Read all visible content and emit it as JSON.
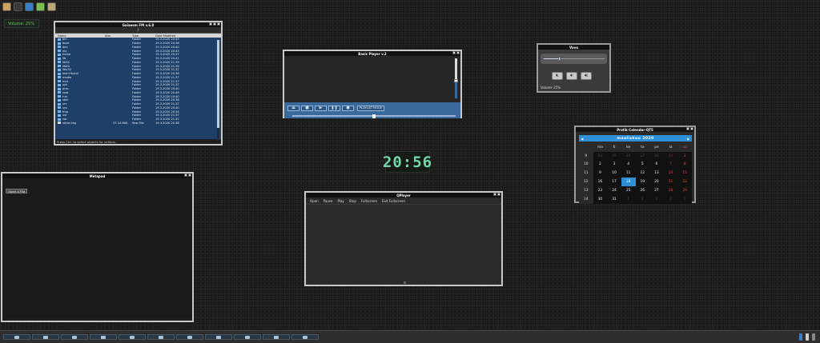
{
  "launcher": {
    "icons": [
      {
        "name": "file-manager-launcher-icon",
        "color": "#c8a060"
      },
      {
        "name": "terminal-launcher-icon",
        "color": "#3a3a3a"
      },
      {
        "name": "browser-launcher-icon",
        "color": "#3a7ec8"
      },
      {
        "name": "editor-launcher-icon",
        "color": "#7ac050"
      },
      {
        "name": "settings-launcher-icon",
        "color": "#b8a878"
      }
    ]
  },
  "volume_indicator": {
    "text": "Volume: 25%"
  },
  "file_manager": {
    "title": "Gaiaesm FM v.6.0",
    "path": "/",
    "columns": {
      "name": "Name",
      "size": "Size",
      "type": "Type",
      "date": "Date Modified"
    },
    "rows": [
      {
        "name": "bin",
        "size": "",
        "type": "Folder",
        "date": "19.3.2020 20.45"
      },
      {
        "name": "boot",
        "size": "",
        "type": "Folder",
        "date": "19.3.2020 20.38"
      },
      {
        "name": "dev",
        "size": "",
        "type": "Folder",
        "date": "19.3.2020 20.40"
      },
      {
        "name": "etc",
        "size": "",
        "type": "Folder",
        "date": "19.3.2020 20.45"
      },
      {
        "name": "home",
        "size": "",
        "type": "Folder",
        "date": "15.3.2020 20.37"
      },
      {
        "name": "lib",
        "size": "",
        "type": "Folder",
        "date": "19.3.2020 20.41"
      },
      {
        "name": "lib32",
        "size": "",
        "type": "Folder",
        "date": "15.3.2020 21.39"
      },
      {
        "name": "lib64",
        "size": "",
        "type": "Folder",
        "date": "15.3.2020 21.39"
      },
      {
        "name": "libx32",
        "size": "",
        "type": "Folder",
        "date": "15.3.2020 21.37"
      },
      {
        "name": "lost+found",
        "size": "",
        "type": "Folder",
        "date": "15.3.2020 20.38"
      },
      {
        "name": "media",
        "size": "",
        "type": "Folder",
        "date": "15.3.2020 21.37"
      },
      {
        "name": "mnt",
        "size": "",
        "type": "Folder",
        "date": "15.3.2020 21.37"
      },
      {
        "name": "opt",
        "size": "",
        "type": "Folder",
        "date": "15.3.2020 21.37"
      },
      {
        "name": "proc",
        "size": "",
        "type": "Folder",
        "date": "19.3.2020 20.40"
      },
      {
        "name": "root",
        "size": "",
        "type": "Folder",
        "date": "19.3.2020 20.49"
      },
      {
        "name": "run",
        "size": "",
        "type": "Folder",
        "date": "19.3.2020 20.40"
      },
      {
        "name": "sbin",
        "size": "",
        "type": "Folder",
        "date": "19.3.2020 20.38"
      },
      {
        "name": "srv",
        "size": "",
        "type": "Folder",
        "date": "15.3.2020 21.37"
      },
      {
        "name": "sys",
        "size": "",
        "type": "Folder",
        "date": "19.3.2020 20.40"
      },
      {
        "name": "tmp",
        "size": "",
        "type": "Folder",
        "date": "19.3.2020 20.54"
      },
      {
        "name": "usr",
        "size": "",
        "type": "Folder",
        "date": "15.3.2020 21.37"
      },
      {
        "name": "var",
        "size": "",
        "type": "Folder",
        "date": "15.3.2020 21.37"
      },
      {
        "name": "initrd.img",
        "size": "57.14 MiB",
        "type": "Raw File",
        "date": "19.3.2020 20.38"
      }
    ],
    "status": "Press Ctrl. to select objects for actions."
  },
  "basic_player": {
    "title": "Basic Player v.2",
    "buttons": [
      {
        "name": "eject-button",
        "glyph": "⏏"
      },
      {
        "name": "stop-button",
        "glyph": "■"
      },
      {
        "name": "play-button",
        "glyph": "▶"
      },
      {
        "name": "pause-button",
        "glyph": "❚❚"
      },
      {
        "name": "record-button",
        "glyph": "●"
      }
    ],
    "mode_label": "PLAYLIST MODE",
    "volume_level": 0.45,
    "position": 0.5
  },
  "volume_widget": {
    "title": "Vovo",
    "level": 0.25,
    "label": "Volume 25%"
  },
  "calendar": {
    "title": "Pratik Calendar-QT5",
    "month_label": "maaliskuu  2020",
    "weekdays": [
      "ma",
      "ti",
      "ke",
      "to",
      "pe",
      "la",
      "su"
    ],
    "weeks": [
      {
        "wk": "9",
        "days": [
          {
            "d": "24",
            "o": true
          },
          {
            "d": "25",
            "o": true
          },
          {
            "d": "26",
            "o": true
          },
          {
            "d": "27",
            "o": true
          },
          {
            "d": "28",
            "o": true
          },
          {
            "d": "29",
            "o": true
          },
          {
            "d": "1"
          }
        ]
      },
      {
        "wk": "10",
        "days": [
          {
            "d": "2"
          },
          {
            "d": "3"
          },
          {
            "d": "4"
          },
          {
            "d": "5"
          },
          {
            "d": "6"
          },
          {
            "d": "7"
          },
          {
            "d": "8"
          }
        ]
      },
      {
        "wk": "11",
        "days": [
          {
            "d": "9"
          },
          {
            "d": "10"
          },
          {
            "d": "11"
          },
          {
            "d": "12"
          },
          {
            "d": "13"
          },
          {
            "d": "14"
          },
          {
            "d": "15"
          }
        ]
      },
      {
        "wk": "12",
        "days": [
          {
            "d": "16"
          },
          {
            "d": "17"
          },
          {
            "d": "18",
            "t": true
          },
          {
            "d": "19"
          },
          {
            "d": "20"
          },
          {
            "d": "21"
          },
          {
            "d": "22"
          }
        ]
      },
      {
        "wk": "13",
        "days": [
          {
            "d": "23"
          },
          {
            "d": "24"
          },
          {
            "d": "25"
          },
          {
            "d": "26"
          },
          {
            "d": "27"
          },
          {
            "d": "28"
          },
          {
            "d": "29"
          }
        ]
      },
      {
        "wk": "14",
        "days": [
          {
            "d": "30"
          },
          {
            "d": "31"
          },
          {
            "d": "1",
            "o": true
          },
          {
            "d": "2",
            "o": true
          },
          {
            "d": "3",
            "o": true
          },
          {
            "d": "4",
            "o": true
          },
          {
            "d": "5",
            "o": true
          }
        ]
      }
    ]
  },
  "clock": {
    "time": "20:56"
  },
  "metapad": {
    "title": "Metapad",
    "filename": "",
    "open_button": "Open a File"
  },
  "qplayer": {
    "title": "QPlayer",
    "menu": [
      "Open",
      "Pause",
      "Play",
      "Stop",
      "Fullscreen",
      "Exit Fullscreen"
    ]
  },
  "taskbar": {
    "items": [
      {
        "name": "taskbar-item-1"
      },
      {
        "name": "taskbar-item-2"
      },
      {
        "name": "taskbar-item-3"
      },
      {
        "name": "taskbar-item-4"
      },
      {
        "name": "taskbar-item-5"
      },
      {
        "name": "taskbar-item-6"
      },
      {
        "name": "taskbar-item-7"
      },
      {
        "name": "taskbar-item-8"
      },
      {
        "name": "taskbar-item-9"
      },
      {
        "name": "taskbar-item-10"
      },
      {
        "name": "taskbar-item-11"
      }
    ],
    "tray": [
      {
        "name": "network-tray-icon",
        "color": "#3a7ec8"
      },
      {
        "name": "volume-tray-icon",
        "color": "#cccccc"
      },
      {
        "name": "battery-tray-icon",
        "color": "#888888"
      }
    ]
  }
}
